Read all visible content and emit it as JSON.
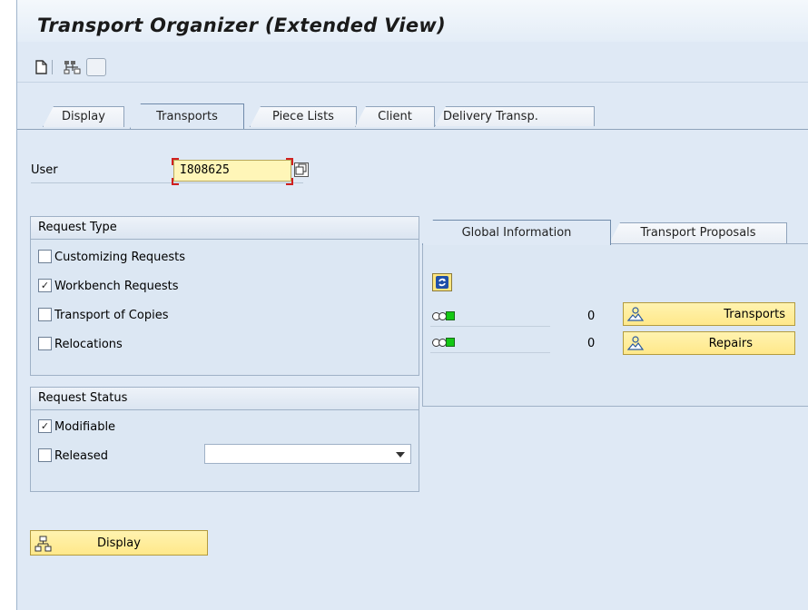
{
  "window": {
    "title": "Transport Organizer (Extended View)"
  },
  "toolbar": {
    "icons": [
      "new-document-icon",
      "hierarchy-icon",
      "blank-button"
    ]
  },
  "tabs": [
    {
      "label": "Display",
      "active": false
    },
    {
      "label": "Transports",
      "active": true
    },
    {
      "label": "Piece Lists",
      "active": false
    },
    {
      "label": "Client",
      "active": false
    },
    {
      "label": "Delivery Transp.",
      "active": false
    }
  ],
  "user": {
    "label": "User",
    "value": "I808625"
  },
  "request_type": {
    "title": "Request Type",
    "items": [
      {
        "label": "Customizing Requests",
        "checked": false
      },
      {
        "label": "Workbench Requests",
        "checked": true
      },
      {
        "label": "Transport of Copies",
        "checked": false
      },
      {
        "label": "Relocations",
        "checked": false
      }
    ]
  },
  "request_status": {
    "title": "Request Status",
    "modifiable": {
      "label": "Modifiable",
      "checked": true
    },
    "released": {
      "label": "Released",
      "checked": false,
      "dropdown_value": ""
    }
  },
  "info_tabs": [
    {
      "label": "Global Information",
      "active": true
    },
    {
      "label": "Transport Proposals",
      "active": false
    }
  ],
  "global_info": {
    "rows": [
      {
        "count": "0",
        "button_label": "Transports"
      },
      {
        "count": "0",
        "button_label": "Repairs"
      }
    ]
  },
  "display_button": {
    "label": "Display"
  },
  "colors": {
    "accent_yellow": "#ffe88a",
    "panel_blue": "#dce7f3",
    "status_green": "#14c814"
  }
}
